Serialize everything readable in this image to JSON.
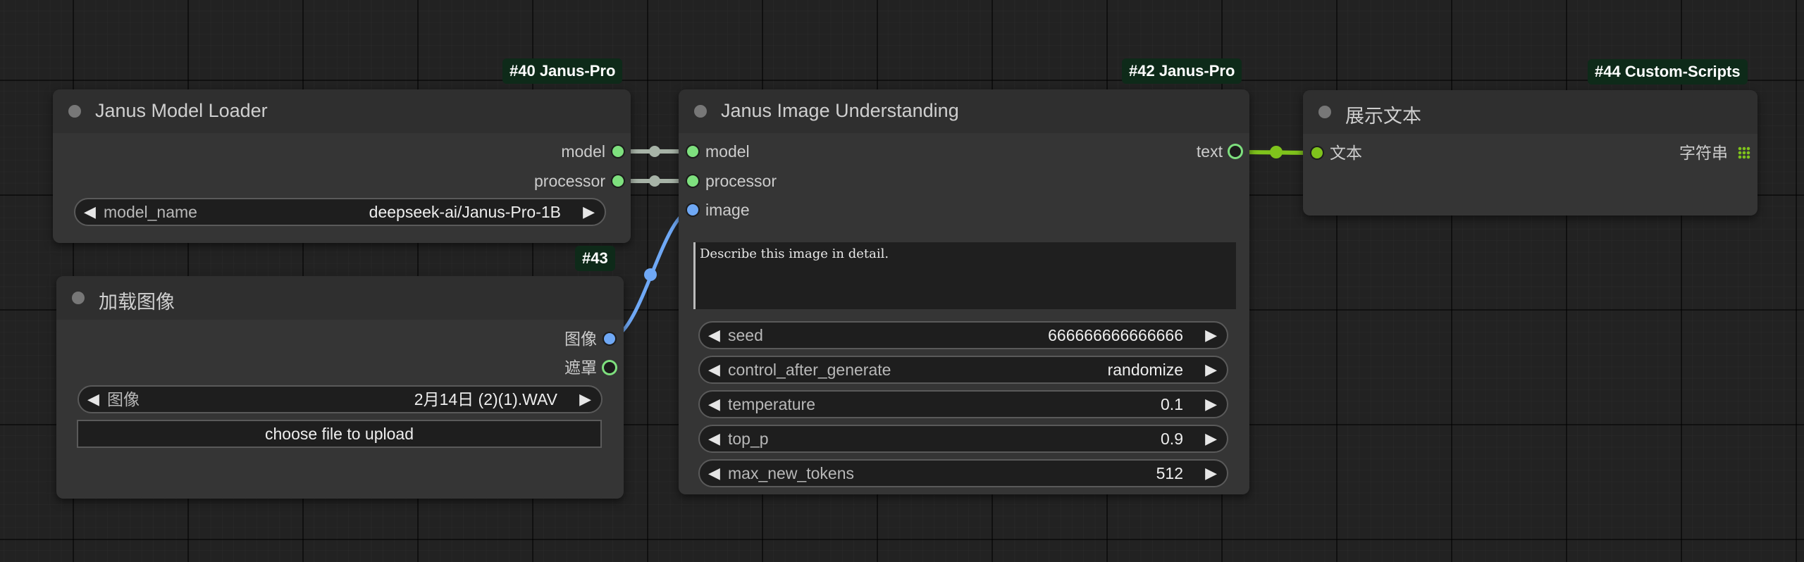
{
  "nodes": {
    "model_loader": {
      "badge": "#40 Janus-Pro",
      "title": "Janus Model Loader",
      "outputs": [
        "model",
        "processor"
      ],
      "widget": {
        "label": "model_name",
        "value": "deepseek-ai/Janus-Pro-1B"
      }
    },
    "load_image": {
      "badge": "#43",
      "title": "加载图像",
      "outputs": [
        "图像",
        "遮罩"
      ],
      "widget": {
        "label": "图像",
        "value": "2月14日 (2)(1).WAV"
      },
      "upload_label": "choose file to upload"
    },
    "image_understanding": {
      "badge": "#42 Janus-Pro",
      "title": "Janus Image Understanding",
      "inputs": [
        "model",
        "processor",
        "image"
      ],
      "output": "text",
      "prompt": "Describe this image in detail.",
      "widgets": [
        {
          "label": "seed",
          "value": "666666666666666"
        },
        {
          "label": "control_after_generate",
          "value": "randomize"
        },
        {
          "label": "temperature",
          "value": "0.1"
        },
        {
          "label": "top_p",
          "value": "0.9"
        },
        {
          "label": "max_new_tokens",
          "value": "512"
        }
      ]
    },
    "show_text": {
      "badge": "#44 Custom-Scripts",
      "title": "展示文本",
      "input": "文本",
      "output_type": "字符串"
    }
  },
  "colors": {
    "canvas": "#222222",
    "node_body": "#353535",
    "node_header": "#2f2f2f",
    "badge_bg": "#0e2a19",
    "link_model": "#a7b3a7",
    "link_image": "#6fa8f5",
    "link_text": "#7fc31c"
  },
  "icons": {
    "widget_arrows": [
      "triangle-left-icon",
      "triangle-right-icon"
    ],
    "output_type": "grip-dots-icon"
  }
}
